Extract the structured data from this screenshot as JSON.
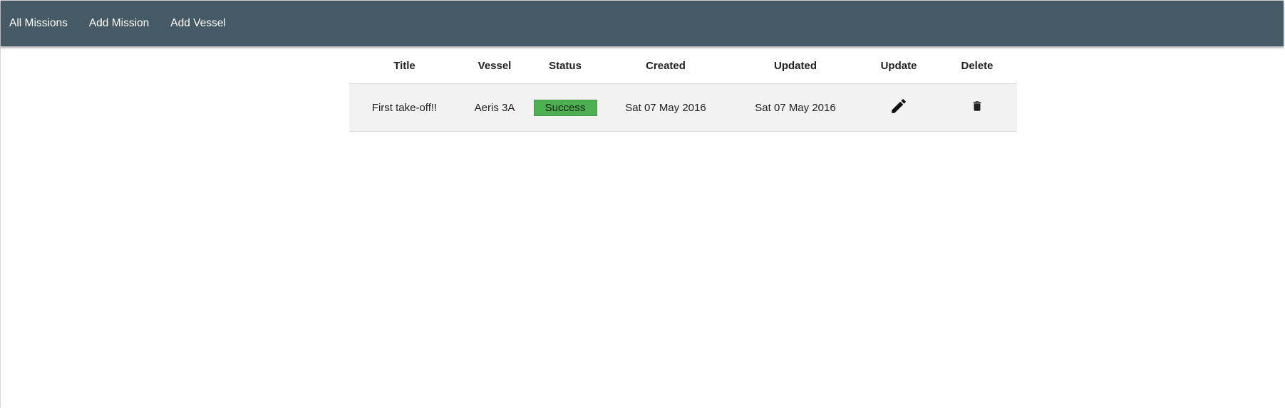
{
  "nav": {
    "items": [
      {
        "label": "All Missions"
      },
      {
        "label": "Add Mission"
      },
      {
        "label": "Add Vessel"
      }
    ]
  },
  "table": {
    "headers": {
      "title": "Title",
      "vessel": "Vessel",
      "status": "Status",
      "created": "Created",
      "updated": "Updated",
      "update": "Update",
      "delete": "Delete"
    },
    "rows": [
      {
        "title": "First take-off!!",
        "vessel": "Aeris 3A",
        "status": "Success",
        "created": "Sat 07 May 2016",
        "updated": "Sat 07 May 2016",
        "update_icon": "pencil-icon",
        "delete_icon": "trash-icon"
      }
    ]
  },
  "colors": {
    "topbar": "#455a64",
    "success": "#4caf50",
    "row_background": "#f2f2f2"
  }
}
